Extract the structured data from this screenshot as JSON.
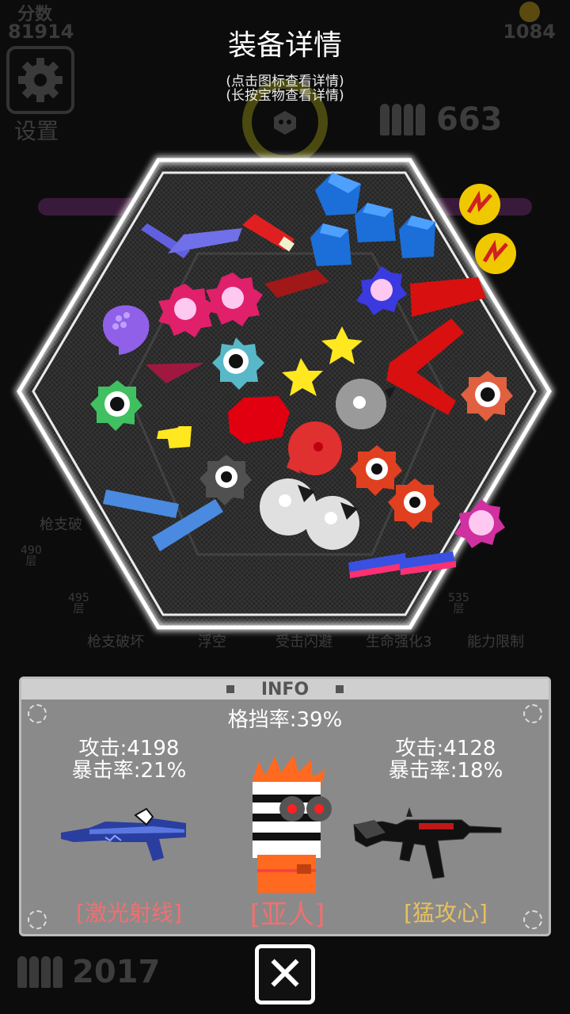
{
  "hud": {
    "score_label": "分数",
    "score_value": "81914",
    "coin_value": "1084",
    "settings_label": "设置",
    "ammo_top": "663",
    "ammo_bottom": "2017"
  },
  "header": {
    "title": "装备详情",
    "hint1": "(点击图标查看详情)",
    "hint2": "(长按宝物查看详情)"
  },
  "background_skills": {
    "floors": [
      "490\n层",
      "495\n层",
      "535\n层"
    ],
    "skills": [
      "枪支破坏",
      "浮空",
      "受击闪避",
      "生命强化3",
      "能力限制"
    ],
    "partial_label": "枪支破"
  },
  "info": {
    "title": "INFO",
    "block_rate": "格挡率:39%",
    "left": {
      "attack": "攻击:4198",
      "crit": "暴击率:21%",
      "name": "[激光射线]"
    },
    "center": {
      "name": "[亚人]"
    },
    "right": {
      "attack": "攻击:4128",
      "crit": "暴击率:18%",
      "name": "[猛攻心]"
    }
  },
  "colors": {
    "hex_border": "#ffffff",
    "accent_red": "#f07070",
    "accent_gold": "#e8c060"
  },
  "icons": {
    "settings": "gear-icon",
    "close": "close-icon",
    "coin": "coin-icon",
    "ammo": "bullet-icon"
  }
}
